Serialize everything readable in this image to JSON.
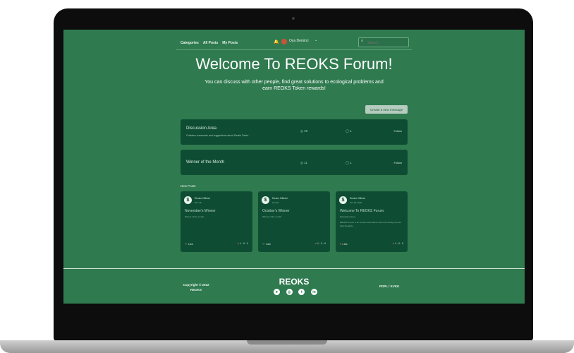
{
  "nav": {
    "categories": "Categories",
    "all_posts": "All Posts",
    "my_posts": "My Posts",
    "user_name": "Oya Demirci",
    "search_placeholder": "Search"
  },
  "hero": {
    "title": "Welcome To REOKS Forum!",
    "subtitle": "You can discuss with other people, find great solutions to ecological problems and earn REOKS Token rewards!"
  },
  "actions": {
    "create_message": "Create a new message"
  },
  "categories": [
    {
      "title": "Discussion Area",
      "description": "Contains comments and suggestions about Reoks Token",
      "posts": "29",
      "comments": "1",
      "follow": "Follow"
    },
    {
      "title": "Winner of the Month",
      "description": "",
      "posts": "11",
      "comments": "1",
      "follow": "Follow"
    }
  ],
  "new_posts_label": "New Posts",
  "posts": [
    {
      "author": "Reoks Official",
      "date": "Dec 15",
      "title": "November's Winner",
      "category": "Winner of the month",
      "excerpt": "",
      "like": "Like",
      "stats": "1 · 0 · 0"
    },
    {
      "author": "Reoks Official",
      "date": "Oct 28",
      "title": "October's Winner",
      "category": "Winner of the month",
      "excerpt": "",
      "like": "Like",
      "stats": "1 · 0 · 0"
    },
    {
      "author": "Reoks Official",
      "date": "Oct 18, 2022",
      "title": "Welcome To REOKS Forum",
      "category": "Discussion Area",
      "excerpt": "REOKS Forum is an environment where users can freely express their thoughts...",
      "like": "Like",
      "stats": "1 · 0 · 0"
    }
  ],
  "footer": {
    "copyright": "Copyright © 2022",
    "company": "REOKS",
    "brand": "REOKS",
    "lang": "PDPL / KVKK",
    "socials": [
      "telegram-icon",
      "instagram-icon",
      "twitter-icon",
      "linkedin-icon"
    ]
  }
}
